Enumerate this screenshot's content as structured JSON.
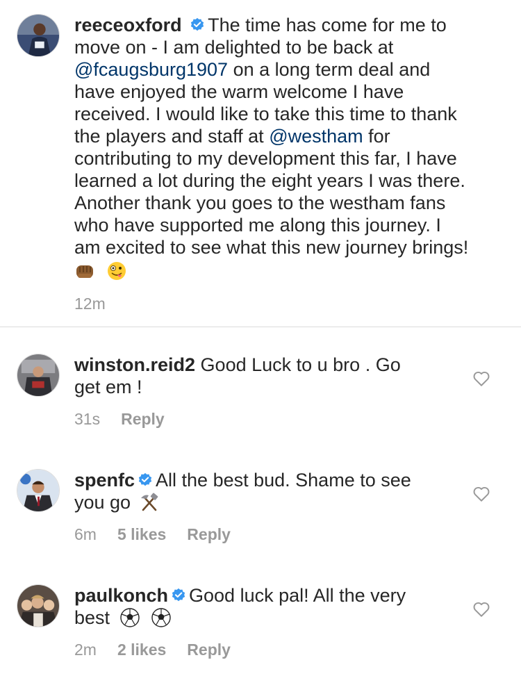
{
  "caption": {
    "username": "reeceoxford",
    "verified_icon": "verified-badge-icon",
    "lines": [
      {
        "pre": "The time has come for me to"
      },
      {
        "pre": "move on - I am delighted to be back at"
      },
      {
        "mention": "@fcaugsburg1907",
        "post": " on a long term deal and"
      },
      {
        "pre": "have enjoyed the warm welcome I have"
      },
      {
        "pre": "received. I would like to take this time to thank"
      },
      {
        "pre": "the players and staff at ",
        "mention": "@westham",
        "post": " for"
      },
      {
        "pre": "contributing to my development this far, I have"
      },
      {
        "pre": "learned a lot during the eight years I was there."
      },
      {
        "pre": "Another thank you goes to the westham fans"
      },
      {
        "pre": "who have supported me along this journey. I"
      },
      {
        "pre": "am excited to see what this new journey brings!"
      }
    ],
    "emojis": [
      "fist-bump-emoji",
      "zany-face-emoji"
    ],
    "time": "12m"
  },
  "comments": [
    {
      "username": "winston.reid2",
      "verified": false,
      "line1": "Good Luck to u bro . Go",
      "line2": "get em !",
      "time": "31s",
      "likes": "",
      "reply": "Reply"
    },
    {
      "username": "spenfc",
      "verified": true,
      "line1": "All the best bud. Shame to see",
      "line2": "you go",
      "line2_emoji": "hammer-and-pick-emoji",
      "time": "6m",
      "likes": "5 likes",
      "reply": "Reply"
    },
    {
      "username": "paulkonch",
      "verified": true,
      "line1": "Good luck pal! All the very",
      "line2": "best",
      "line2_emoji": "soccer-ball-emoji",
      "time": "2m",
      "likes": "2 likes",
      "reply": "Reply"
    }
  ],
  "colors": {
    "text": "#262626",
    "mention": "#003569",
    "meta": "#999999",
    "verified": "#3897f0",
    "divider": "#dbdbdb"
  }
}
